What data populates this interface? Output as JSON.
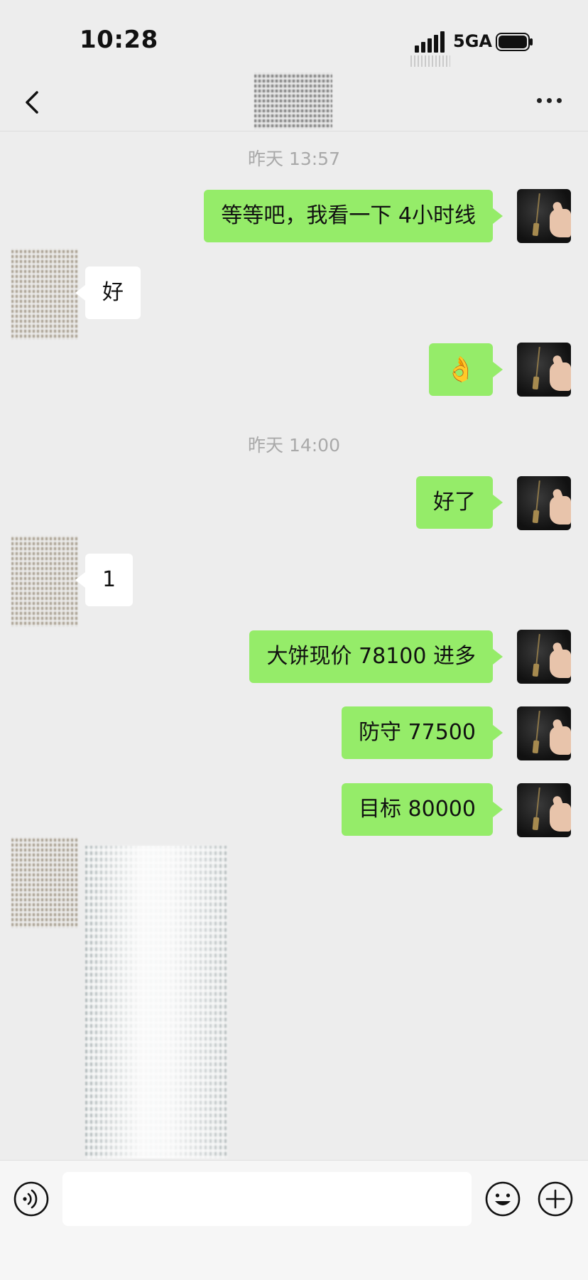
{
  "status_bar": {
    "time": "10:28",
    "network": "5GA"
  },
  "chat": {
    "timestamps": [
      "昨天 13:57",
      "昨天 14:00"
    ],
    "messages": {
      "m1": "等等吧，我看一下 4小时线",
      "m2": "好",
      "m3": "👌",
      "m4": "好了",
      "m5": "1",
      "m6": "大饼现价 78100 进多",
      "m7": "防守 77500",
      "m8": "目标 80000"
    }
  },
  "input": {
    "value": "",
    "placeholder": ""
  },
  "icons": {
    "back": "back-chevron-icon",
    "more": "more-dots-icon",
    "voice": "voice-icon",
    "emoji": "emoji-icon",
    "plus": "plus-icon"
  },
  "colors": {
    "sent_bubble": "#95ec69",
    "received_bubble": "#ffffff",
    "background": "#ededed"
  }
}
